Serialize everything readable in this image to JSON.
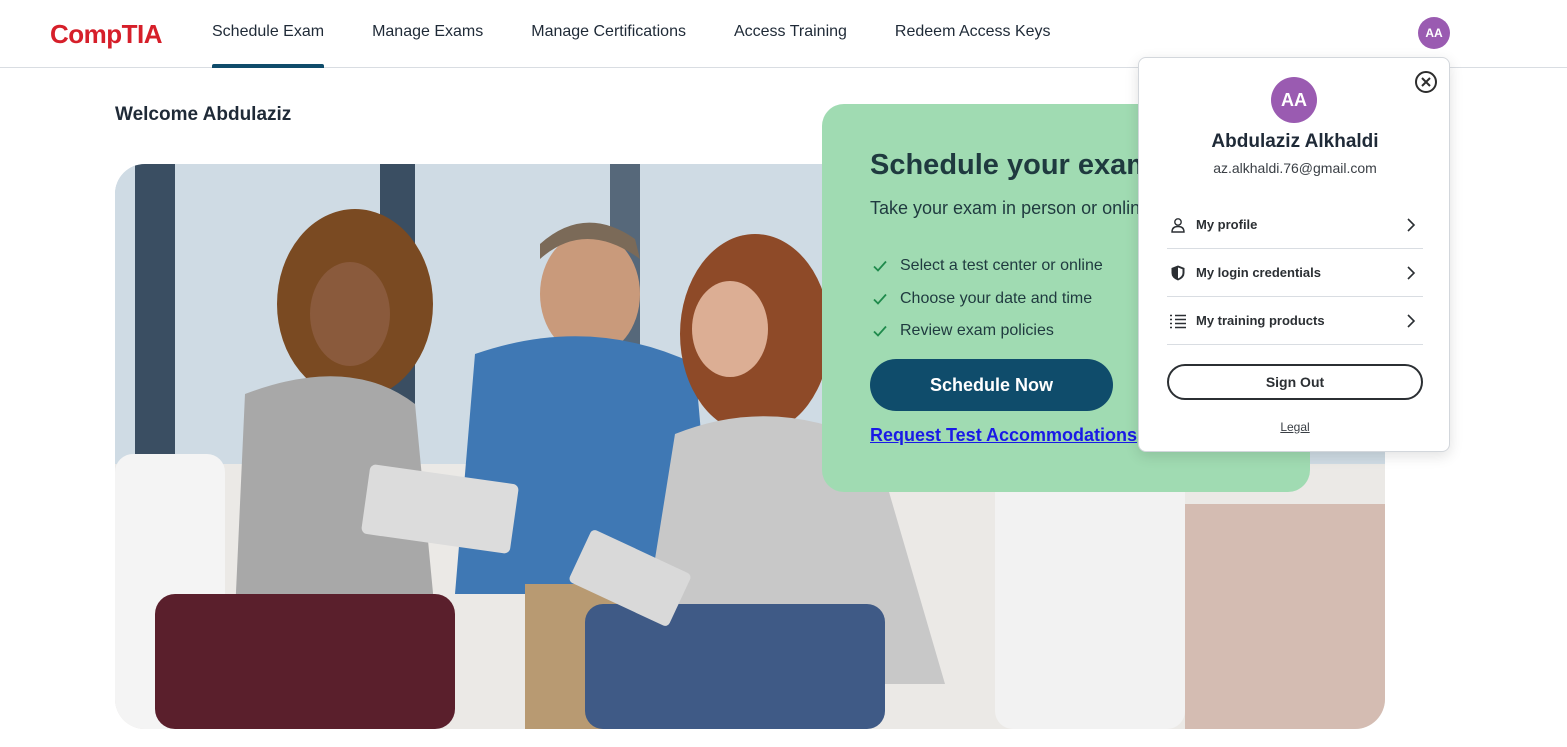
{
  "brand": {
    "logo_text": "CompTIA",
    "logo_mark": ".",
    "accent": "#d61f2a"
  },
  "nav": {
    "items": [
      {
        "label": "Schedule Exam",
        "active": true
      },
      {
        "label": "Manage Exams",
        "active": false
      },
      {
        "label": "Manage Certifications",
        "active": false
      },
      {
        "label": "Access Training",
        "active": false
      },
      {
        "label": "Redeem Access Keys",
        "active": false
      }
    ],
    "avatar_initials": "AA"
  },
  "welcome": "Welcome Abdulaziz",
  "hero_image": {
    "icon": "people-with-tablets-photo"
  },
  "schedule_card": {
    "title": "Schedule your exam",
    "subtitle": "Take your exam in person or online",
    "checklist": [
      "Select a test center or online",
      "Choose your date and time",
      "Review exam policies"
    ],
    "button_label": "Schedule Now",
    "link_label": "Request Test Accommodations",
    "background": "#a0dbb2"
  },
  "profile_popover": {
    "initials": "AA",
    "name": "Abdulaziz Alkhaldi",
    "email": "az.alkhaldi.76@gmail.com",
    "menu": [
      {
        "label": "My profile",
        "icon": "person-icon"
      },
      {
        "label": "My login credentials",
        "icon": "shield-icon"
      },
      {
        "label": "My training products",
        "icon": "list-icon"
      }
    ],
    "signout_label": "Sign Out",
    "legal_label": "Legal",
    "avatar_color": "#9a5bb1"
  }
}
